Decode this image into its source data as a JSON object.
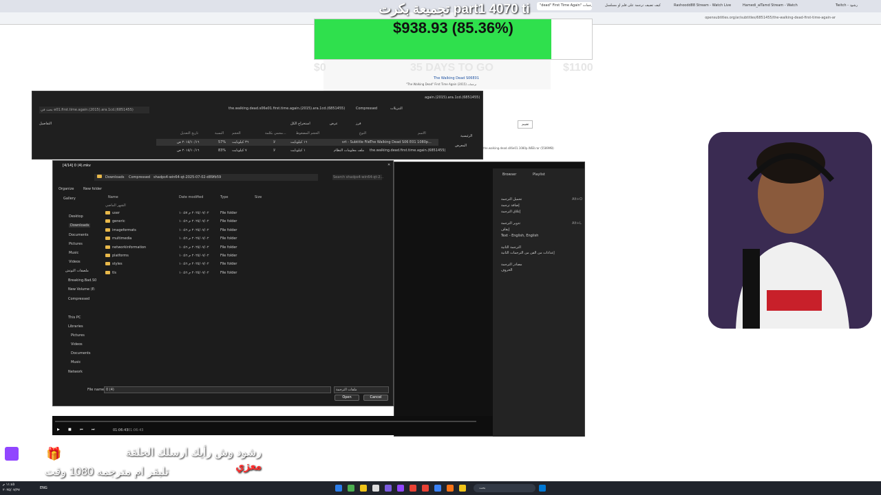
{
  "stream": {
    "title": "part1 4070 ti تجميعة بكرت",
    "goal_amount": "$938.93 (85.36%)",
    "goal_fraction": 0.8536,
    "goal_start": "$0",
    "goal_days": "35 DAYS TO GO",
    "goal_end": "$1100",
    "subtitle_line1": "رشود وش رأيك ارسلك الحلقة",
    "subtitle_user": "معزي",
    "subtitle_line2": "تلبقر ام مترجمه 1080 وقت"
  },
  "browser": {
    "tabs": [
      "\"dead\" First Time Again\" ترجمات",
      "كيف تضيف ترجمة على فلم او مسلسل",
      "Rashoodd88 Stream - Watch Live",
      "Hamedi_alTamd Stream - Watch",
      "Twitch - رشود"
    ],
    "url": "opensubtitles.org/ar/subtitles/6851455/the-walking-dead-first-time-again-ar"
  },
  "site": {
    "series_title": "The Walking Dead",
    "episode": "S06E01",
    "episode_desc": "\"The Walking Dead\" First Time Again (2015) ترجمات",
    "file": "the.walking.dead.s06e01.1080p.WEB.rar (5589MB)",
    "rating_label": "تقييم"
  },
  "explorer": {
    "search_placeholder": "بحث في e01.first.time.again.(2015).ara.1cd.(6851455)",
    "path": "the.walking.dead.s06e01.first.time.again.(2015).ara.1cd.(6851455)",
    "crumb_compressed": "Compressed",
    "crumb_downloads": "التنزيلات",
    "title": "again.(2015).ara.1cd.(6851455)",
    "toolbar_extract": "استخراج الكل",
    "toolbar_view": "عرض",
    "toolbar_sort": "فرز",
    "toolbar_details": "التفاصيل",
    "nav_home": "الرئيسية",
    "nav_gallery": "المعرض",
    "columns": [
      "الاسم",
      "النوع",
      "الحجم المضغوط",
      "محمي بكلمة...",
      "الحجم",
      "النسبة",
      "تاريخ التعديل"
    ],
    "rows": [
      [
        "The Walking Dead S06 E01 1080p...",
        "srt - Subtitle File",
        "١٦ كيلوبايت",
        "لا",
        "٣٦ كيلوبايت",
        "57%",
        "٢٠١٥/١٠/١٦ ص"
      ],
      [
        "the.walking.dead.first.time.again.(6851455)",
        "ملف معلومات النظام",
        "١ كيلوبايت",
        "لا",
        "٧ كيلوبايت",
        "83%",
        "٢٠١٥/١٠/١٦ ص"
      ]
    ],
    "status": "٢ عناصر | تم تحديد ١ عنصر ٣٧٫٠ كيلوبايت"
  },
  "dialog": {
    "title": "[4/14] 0 (4).mkv",
    "breadcrumb": [
      "Downloads",
      "Compressed",
      "shadps4-win64-qt-2025-07-02-d89fb59"
    ],
    "search_placeholder": "Search shadps4-win64-qt-2...",
    "organize": "Organize",
    "new_folder": "New folder",
    "columns": [
      "Name",
      "Date modified",
      "Type",
      "Size"
    ],
    "group_label": "الشهر الماضي",
    "folders": [
      {
        "name": "user",
        "date": "٢٠٢٥/٠٧/٠٢ م ١٠:٥٧",
        "type": "File folder"
      },
      {
        "name": "generic",
        "date": "٢٠٢٥/٠٧/٠٢ م ١٠:٥٦",
        "type": "File folder"
      },
      {
        "name": "imageformats",
        "date": "٢٠٢٥/٠٧/٠٢ م ١٠:٥٦",
        "type": "File folder"
      },
      {
        "name": "multimedia",
        "date": "٢٠٢٥/٠٧/٠٢ م ١٠:٥٦",
        "type": "File folder"
      },
      {
        "name": "networkinformation",
        "date": "٢٠٢٥/٠٧/٠٢ م ١٠:٥٦",
        "type": "File folder"
      },
      {
        "name": "platforms",
        "date": "٢٠٢٥/٠٧/٠٢ م ١٠:٥٦",
        "type": "File folder"
      },
      {
        "name": "styles",
        "date": "٢٠٢٥/٠٧/٠٢ م ١٠:٥٦",
        "type": "File folder"
      },
      {
        "name": "tls",
        "date": "٢٠٢٥/٠٧/٠٢ م ١٠:٥٦",
        "type": "File folder"
      }
    ],
    "sidebar": [
      "Gallery",
      "Desktop",
      "Downloads",
      "Documents",
      "Pictures",
      "Music",
      "Videos",
      "ملصقات التوتش",
      "Breaking.Bad.S0",
      "New Volume (E:",
      "Compressed",
      "This PC",
      "Libraries",
      "Pictures",
      "Videos",
      "Documents",
      "Music",
      "Network"
    ],
    "filename_label": "File name:",
    "filename_value": "0 (4)",
    "filetype_value": "ملفات الترجمة",
    "open_label": "Open",
    "cancel_label": "Cancel"
  },
  "player": {
    "tab_browser": "Browser",
    "tab_playlist": "Playlist",
    "menu": [
      "تحميل الترجمة",
      "إضافة ترجمة",
      "إغلاق الترجمة",
      "تدوير الترجمة",
      "إيقاف",
      "Text - English, English",
      "الترجمة الثانية",
      "إعدادات من الفن من الترجمات الثانية",
      "مصادر الترجمة",
      "الخروف"
    ],
    "shortcut1": "Alt+O",
    "shortcut2": "Alt+L",
    "time": "01:06:43",
    "duration": "01:06:43"
  },
  "taskbar": {
    "lang": "ENG",
    "search_placeholder": "بحث",
    "clock_time": "١١:٤٥ م",
    "clock_date": "٢٠٢٥/٠٧/٢٧"
  },
  "colors": {
    "goal_green": "#2fe04d",
    "folder_yellow": "#e8b84a",
    "twitch_purple": "#9146ff",
    "subtitle_user_red": "#ff3030"
  }
}
